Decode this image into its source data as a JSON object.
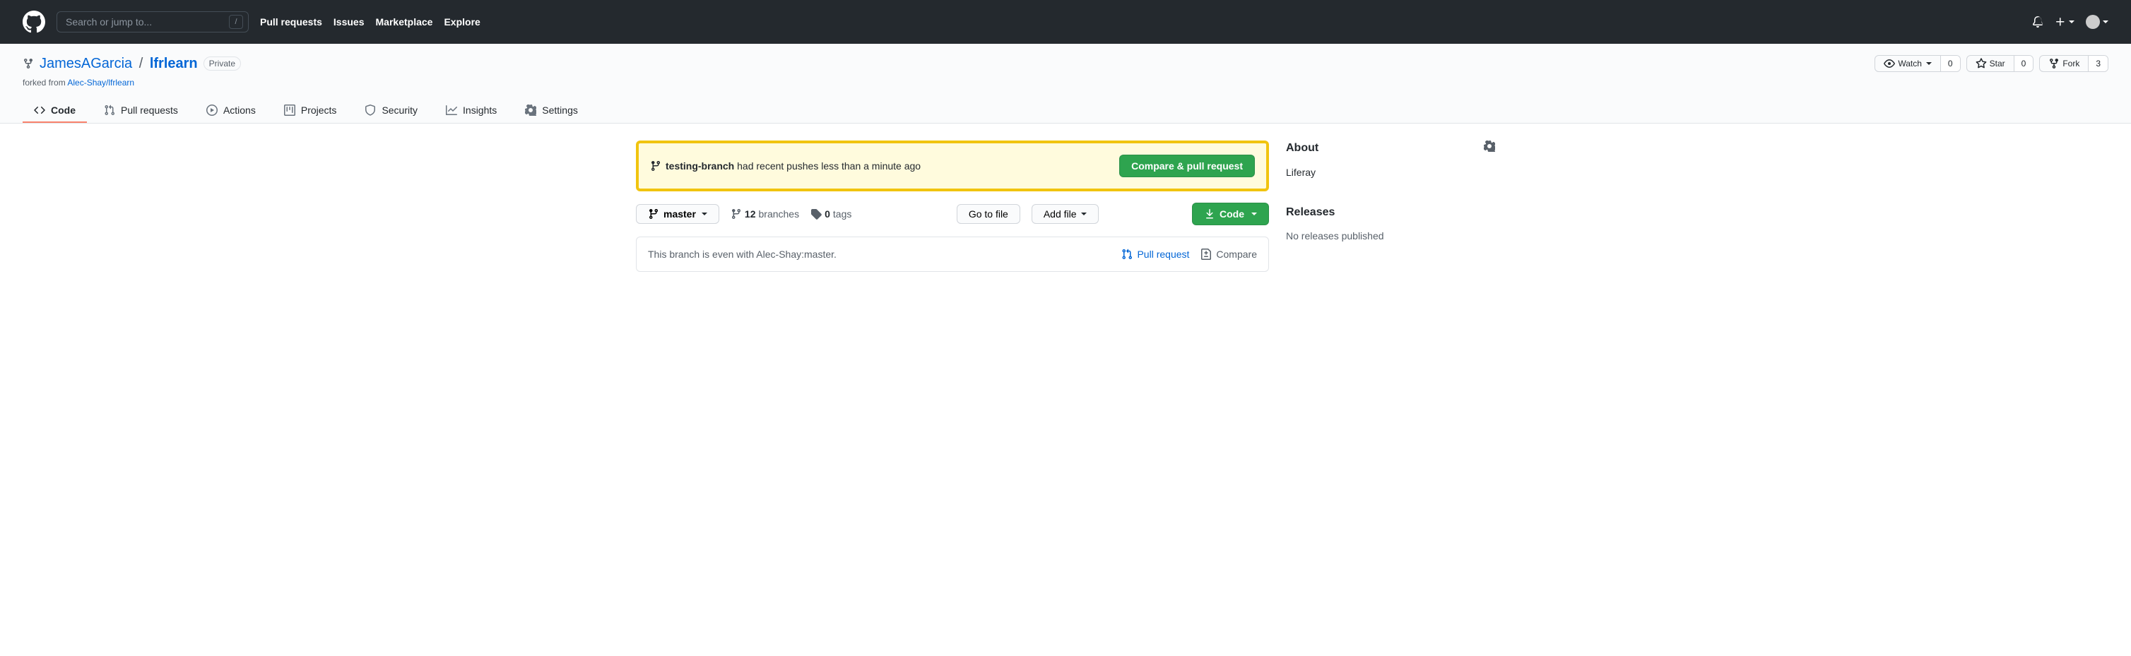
{
  "header": {
    "search_placeholder": "Search or jump to...",
    "slash_key": "/",
    "nav": [
      "Pull requests",
      "Issues",
      "Marketplace",
      "Explore"
    ]
  },
  "repo": {
    "owner": "JamesAGarcia",
    "name": "lfrlearn",
    "visibility": "Private",
    "forked_prefix": "forked from ",
    "forked_from": "Alec-Shay/lfrlearn",
    "watch_label": "Watch",
    "watch_count": "0",
    "star_label": "Star",
    "star_count": "0",
    "fork_label": "Fork",
    "fork_count": "3"
  },
  "tabs": {
    "code": "Code",
    "pulls": "Pull requests",
    "actions": "Actions",
    "projects": "Projects",
    "security": "Security",
    "insights": "Insights",
    "settings": "Settings"
  },
  "flash": {
    "branch": "testing-branch",
    "message": " had recent pushes less than a minute ago",
    "button": "Compare & pull request"
  },
  "filebar": {
    "branch": "master",
    "branches_count": "12",
    "branches_label": " branches",
    "tags_count": "0",
    "tags_label": " tags",
    "goto_file": "Go to file",
    "add_file": "Add file",
    "code_btn": "Code"
  },
  "branch_status": {
    "message": "This branch is even with Alec-Shay:master.",
    "pull_request": "Pull request",
    "compare": "Compare"
  },
  "sidebar": {
    "about_heading": "About",
    "description": "Liferay",
    "releases_heading": "Releases",
    "releases_note": "No releases published"
  }
}
